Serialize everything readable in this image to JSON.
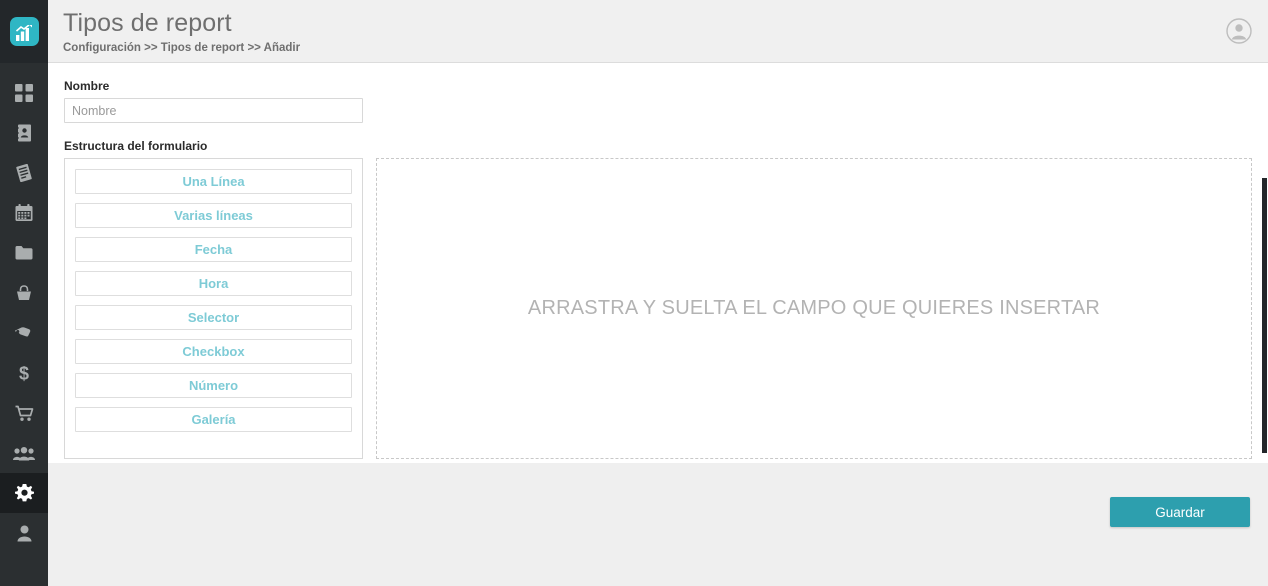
{
  "app": {
    "logo_icon": "bar-chart-logo-icon",
    "accent_color": "#2fb6c4",
    "save_button_color": "#2d9fae",
    "field_text_color": "#7ecbd6"
  },
  "sidebar": {
    "items": [
      {
        "icon": "grid-dashboard-icon",
        "active": false
      },
      {
        "icon": "address-book-icon",
        "active": false
      },
      {
        "icon": "invoice-document-icon",
        "active": false
      },
      {
        "icon": "calendar-icon",
        "active": false
      },
      {
        "icon": "folder-icon",
        "active": false
      },
      {
        "icon": "basket-icon",
        "active": false
      },
      {
        "icon": "tag-icon",
        "active": false
      },
      {
        "icon": "dollar-icon",
        "active": false
      },
      {
        "icon": "shopping-cart-icon",
        "active": false
      },
      {
        "icon": "users-group-icon",
        "active": false
      },
      {
        "icon": "gear-settings-icon",
        "active": true
      },
      {
        "icon": "user-profile-icon",
        "active": false
      }
    ]
  },
  "header": {
    "title": "Tipos de report",
    "breadcrumb": "Configuración >> Tipos de report >> Añadir",
    "avatar_icon": "user-avatar-icon"
  },
  "form": {
    "name_label": "Nombre",
    "name_value": "",
    "name_placeholder": "Nombre",
    "structure_label": "Estructura del formulario",
    "field_types": [
      {
        "label": "Una Línea"
      },
      {
        "label": "Varias líneas"
      },
      {
        "label": "Fecha"
      },
      {
        "label": "Hora"
      },
      {
        "label": "Selector"
      },
      {
        "label": "Checkbox"
      },
      {
        "label": "Número"
      },
      {
        "label": "Galería"
      }
    ],
    "dropzone_text": "ARRASTRA Y SUELTA EL CAMPO QUE QUIERES INSERTAR"
  },
  "footer": {
    "save_label": "Guardar"
  }
}
